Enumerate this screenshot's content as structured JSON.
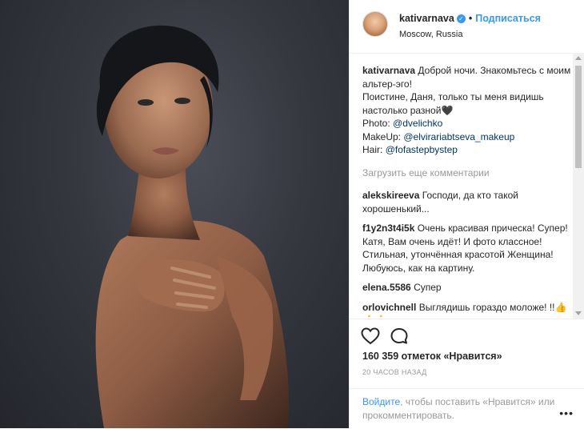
{
  "post": {
    "username": "kativarnava",
    "verified": true,
    "follow_label": "Подписаться",
    "location": "Moscow, Russia",
    "caption": {
      "username": "kativarnava",
      "line1": "Доброй ночи. Знакомьтесь с моим альтер-эго!",
      "line2": "Поистине, Даня, только ты меня видишь настолько разной🖤",
      "photo_label": "Photo:",
      "photo_mention": "@dvelichko",
      "makeup_label": "MakeUp:",
      "makeup_mention": "@elvirariabtseva_makeup",
      "hair_label": "Hair:",
      "hair_mention": "@fofastepbystep"
    },
    "load_more": "Загрузить еще комментарии",
    "comments": [
      {
        "username": "alekskireeva",
        "text": "Господи, да кто такой хорошенький..."
      },
      {
        "username": "f1y2n3t4i5k",
        "text": "Очень красивая прическа! Супер! Катя, Вам очень идёт! И фото классное! Стильная, утончённая красотой Женщина! Любуюсь, как на картину."
      },
      {
        "username": "elena.5586",
        "text": "Супер"
      },
      {
        "username": "orlovichnell",
        "text": "Выглядишь гораздо моложе! !!👍👍👍"
      }
    ],
    "likes": "160 359 отметок «Нравится»",
    "timestamp": "20 ЧАСОВ НАЗАД",
    "login_link": "Войдите",
    "login_text": ", чтобы поставить «Нравится» или прокомментировать.",
    "more_label": "•••"
  },
  "icons": {
    "heart": "heart-icon",
    "comment": "comment-icon",
    "verified": "verified-badge-icon",
    "more": "more-options-icon"
  },
  "colors": {
    "link": "#3897f0",
    "mention": "#003569",
    "muted": "#999999",
    "text": "#262626",
    "background": "#2f3139"
  }
}
